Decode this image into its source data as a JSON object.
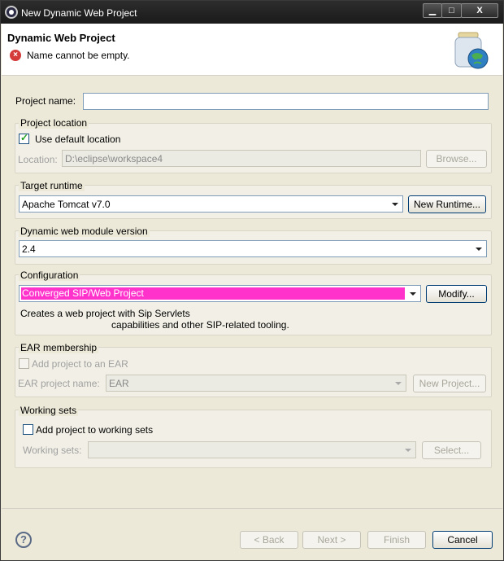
{
  "window": {
    "title": "New Dynamic Web Project",
    "min_glyph": "▁",
    "max_glyph": "□",
    "close_glyph": "X"
  },
  "header": {
    "title": "Dynamic Web Project",
    "error_glyph": "×",
    "error_message": "Name cannot be empty."
  },
  "project_name": {
    "label": "Project name:",
    "value": ""
  },
  "project_location": {
    "group_label": "Project location",
    "use_default_label": "Use default location",
    "use_default_checked": true,
    "location_label": "Location:",
    "location_value": "D:\\eclipse\\workspace4",
    "browse_label": "Browse..."
  },
  "target_runtime": {
    "group_label": "Target runtime",
    "value": "Apache Tomcat v7.0",
    "new_runtime_label": "New Runtime..."
  },
  "module_version": {
    "group_label": "Dynamic web module version",
    "value": "2.4"
  },
  "configuration": {
    "group_label": "Configuration",
    "value": "Converged SIP/Web Project",
    "modify_label": "Modify...",
    "description_line1": "Creates a web project with Sip Servlets",
    "description_line2": "capabilities and other SIP-related tooling."
  },
  "ear_membership": {
    "group_label": "EAR membership",
    "add_to_ear_label": "Add project to an EAR",
    "ear_name_label": "EAR project name:",
    "ear_name_value": "EAR",
    "new_project_label": "New Project..."
  },
  "working_sets": {
    "group_label": "Working sets",
    "add_label": "Add project to working sets",
    "sets_label": "Working sets:",
    "sets_value": "",
    "select_label": "Select..."
  },
  "footer": {
    "help_glyph": "?",
    "back_label": "< Back",
    "next_label": "Next >",
    "finish_label": "Finish",
    "cancel_label": "Cancel"
  }
}
